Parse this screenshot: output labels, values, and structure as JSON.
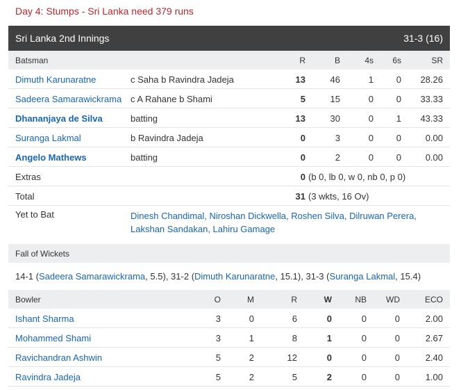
{
  "status": "Day 4: Stumps - Sri Lanka need 379 runs",
  "innings": {
    "title": "Sri Lanka 2nd Innings",
    "score": "31-3 (16)"
  },
  "batting_header": {
    "batsman": "Batsman",
    "r": "R",
    "b": "B",
    "fours": "4s",
    "sixes": "6s",
    "sr": "SR"
  },
  "batsmen": [
    {
      "name": "Dimuth Karunaratne",
      "dismissal": "c Saha b Ravindra Jadeja",
      "r": "13",
      "b": "46",
      "fours": "1",
      "sixes": "0",
      "sr": "28.26",
      "not_out": false
    },
    {
      "name": "Sadeera Samarawickrama",
      "dismissal": "c A Rahane b Shami",
      "r": "5",
      "b": "15",
      "fours": "0",
      "sixes": "0",
      "sr": "33.33",
      "not_out": false
    },
    {
      "name": "Dhananjaya de Silva",
      "dismissal": "batting",
      "r": "13",
      "b": "30",
      "fours": "0",
      "sixes": "1",
      "sr": "43.33",
      "not_out": true
    },
    {
      "name": "Suranga Lakmal",
      "dismissal": "b Ravindra Jadeja",
      "r": "0",
      "b": "3",
      "fours": "0",
      "sixes": "0",
      "sr": "0.00",
      "not_out": false
    },
    {
      "name": "Angelo Mathews",
      "dismissal": "batting",
      "r": "0",
      "b": "2",
      "fours": "0",
      "sixes": "0",
      "sr": "0.00",
      "not_out": true
    }
  ],
  "extras": {
    "label": "Extras",
    "value": "0",
    "detail": "(b 0, lb 0, w 0, nb 0, p 0)"
  },
  "total": {
    "label": "Total",
    "value": "31",
    "detail": "(3 wkts, 16 Ov)"
  },
  "yet_to_bat": {
    "label": "Yet to Bat",
    "players": [
      "Dinesh Chandimal",
      "Niroshan Dickwella",
      "Roshen Silva",
      "Dilruwan Perera",
      "Lakshan Sandakan",
      "Lahiru Gamage"
    ]
  },
  "fall_of_wickets": {
    "label": "Fall of Wickets",
    "items": [
      {
        "score": "14-1",
        "player": "Sadeera Samarawickrama",
        "over": "5.5"
      },
      {
        "score": "31-2",
        "player": "Dimuth Karunaratne",
        "over": "15.1"
      },
      {
        "score": "31-3",
        "player": "Suranga Lakmal",
        "over": "15.4"
      }
    ]
  },
  "bowling_header": {
    "bowler": "Bowler",
    "o": "O",
    "m": "M",
    "r": "R",
    "w": "W",
    "nb": "NB",
    "wd": "WD",
    "eco": "ECO"
  },
  "bowlers": [
    {
      "name": "Ishant Sharma",
      "o": "3",
      "m": "0",
      "r": "6",
      "w": "0",
      "nb": "0",
      "wd": "0",
      "eco": "2.00"
    },
    {
      "name": "Mohammed Shami",
      "o": "3",
      "m": "1",
      "r": "8",
      "w": "1",
      "nb": "0",
      "wd": "0",
      "eco": "2.67"
    },
    {
      "name": "Ravichandran Ashwin",
      "o": "5",
      "m": "2",
      "r": "12",
      "w": "0",
      "nb": "0",
      "wd": "0",
      "eco": "2.40"
    },
    {
      "name": "Ravindra Jadeja",
      "o": "5",
      "m": "2",
      "r": "5",
      "w": "2",
      "nb": "0",
      "wd": "0",
      "eco": "1.00"
    }
  ],
  "colors": {
    "status": "#c0252b",
    "header_bg": "#404040",
    "link": "#1866b4",
    "subheader_bg": "#eceeef"
  }
}
